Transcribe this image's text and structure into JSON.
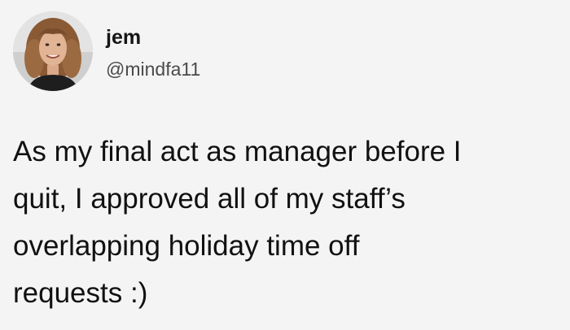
{
  "author": {
    "name": "jem",
    "handle": "@mindfa11",
    "avatar_icon": "profile-photo"
  },
  "tweet": {
    "lines": [
      "As my final act as manager before I",
      "quit, I approved all of my staff’s",
      "overlapping holiday time off",
      "requests :)"
    ]
  },
  "colors": {
    "background": "#f4f4f4",
    "text": "#111111",
    "handle": "#4a4a4a"
  }
}
